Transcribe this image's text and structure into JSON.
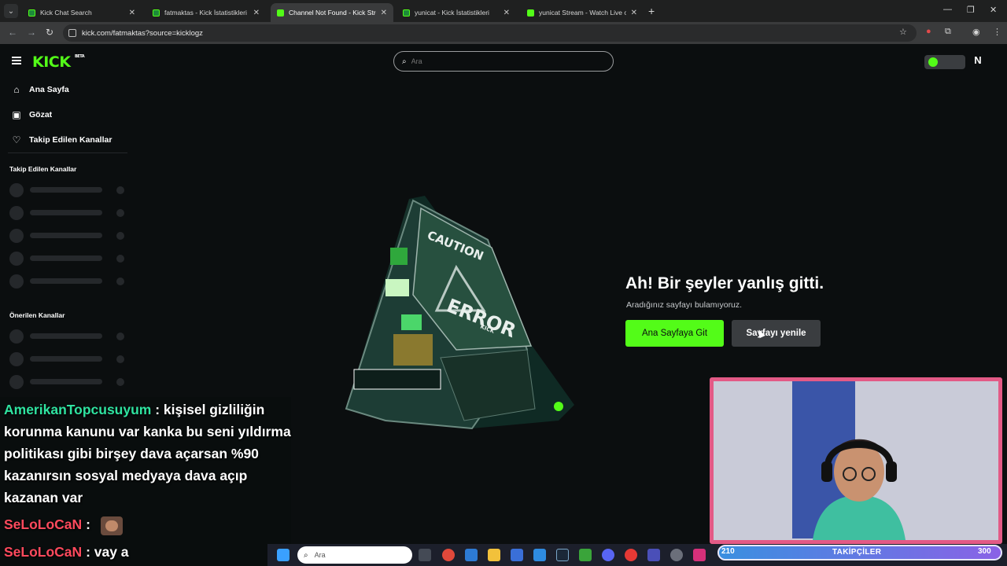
{
  "browser": {
    "tabs": [
      {
        "title": "Kick Chat Search",
        "favicon": "kick-green",
        "active": false
      },
      {
        "title": "fatmaktas - Kick İstatistikleri",
        "favicon": "stats",
        "active": false
      },
      {
        "title": "Channel Not Found - Kick Strea",
        "favicon": "kick-logo",
        "active": true
      },
      {
        "title": "yunicat - Kick İstatistikleri",
        "favicon": "stats",
        "active": false
      },
      {
        "title": "yunicat Stream - Watch Live on",
        "favicon": "kick-logo",
        "active": false
      }
    ],
    "url": "kick.com/fatmaktas?source=kicklogz"
  },
  "header": {
    "logo": "KICK",
    "logo_badge": "BETA",
    "search_placeholder": "Ara",
    "user_initial": "N"
  },
  "sidebar": {
    "nav": [
      {
        "label": "Ana Sayfa",
        "icon": "home-icon"
      },
      {
        "label": "Gözat",
        "icon": "browse-icon"
      },
      {
        "label": "Takip Edilen Kanallar",
        "icon": "heart-icon"
      }
    ],
    "followed_heading": "Takip Edilen Kanallar",
    "suggested_heading": "Önerilen Kanallar"
  },
  "error": {
    "title": "Ah! Bir şeyler yanlış gitti.",
    "subtitle": "Aradığınız sayfayı bulamıyoruz.",
    "home_button": "Ana Sayfaya Git",
    "refresh_button": "Sayfayı yenile",
    "sign_caution": "CAUTION",
    "sign_error": "ERROR",
    "sign_kick": "KICK"
  },
  "chat": [
    {
      "user": "AmerikanTopcusuyum",
      "color": "#2fe3a0",
      "message": ": kişisel gizliliğin"
    },
    {
      "text": "korunma kanunu var kanka bu seni yıldırma"
    },
    {
      "text": "politikası gibi birşey dava açarsan %90"
    },
    {
      "text": "kazanırsın sosyal medyaya dava açıp"
    },
    {
      "text": "kazanan var"
    },
    {
      "user": "SeLoLoCaN",
      "color": "#ff4a5d",
      "message": ":"
    },
    {
      "user": "SeLoLoCaN",
      "color": "#ff4a5d",
      "message": ": vay a"
    }
  ],
  "taskbar": {
    "search_placeholder": "Ara"
  },
  "follower_bar": {
    "count": "210",
    "label": "TAKİPÇİLER",
    "goal": "300"
  },
  "colors": {
    "accent": "#53fc18",
    "background": "#0b0e0f",
    "webcam_border": "#e35a86"
  }
}
